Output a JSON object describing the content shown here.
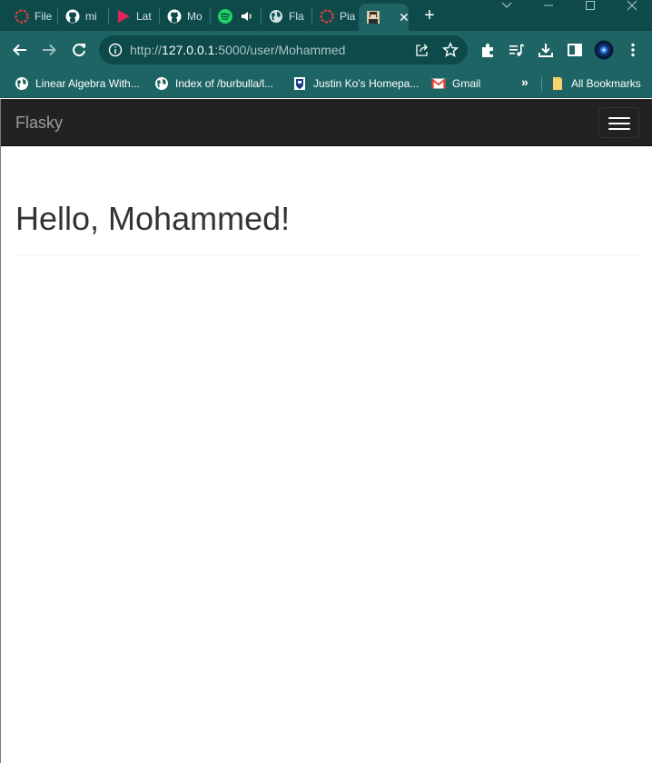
{
  "browser": {
    "tabs": [
      {
        "title": "File",
        "icon": "red-circle-icon"
      },
      {
        "title": "mi",
        "icon": "github-icon"
      },
      {
        "title": "Lat",
        "icon": "pink-play-icon"
      },
      {
        "title": "Mo",
        "icon": "github-icon"
      },
      {
        "title": "",
        "icon": "spotify-icon",
        "audio": "speaker-icon"
      },
      {
        "title": "Fla",
        "icon": "globe-icon"
      },
      {
        "title": "Pia",
        "icon": "red-circle-icon"
      },
      {
        "title": "",
        "icon": "portrait-icon",
        "active": true
      }
    ],
    "url_host": "127.0.0.1",
    "url_rest": ":5000/user/Mohammed",
    "url_scheme": "http://",
    "bookmarks": [
      {
        "label": "Linear Algebra With...",
        "icon": "globe-icon"
      },
      {
        "label": "Index of /burbulla/l...",
        "icon": "globe-icon"
      },
      {
        "label": "Justin Ko's Homepa...",
        "icon": "crest-icon"
      },
      {
        "label": "Gmail",
        "icon": "gmail-icon"
      }
    ],
    "all_bookmarks": "All Bookmarks",
    "accent_color": "#1f6464"
  },
  "app": {
    "brand": "Flasky",
    "heading": "Hello, Mohammed!"
  }
}
